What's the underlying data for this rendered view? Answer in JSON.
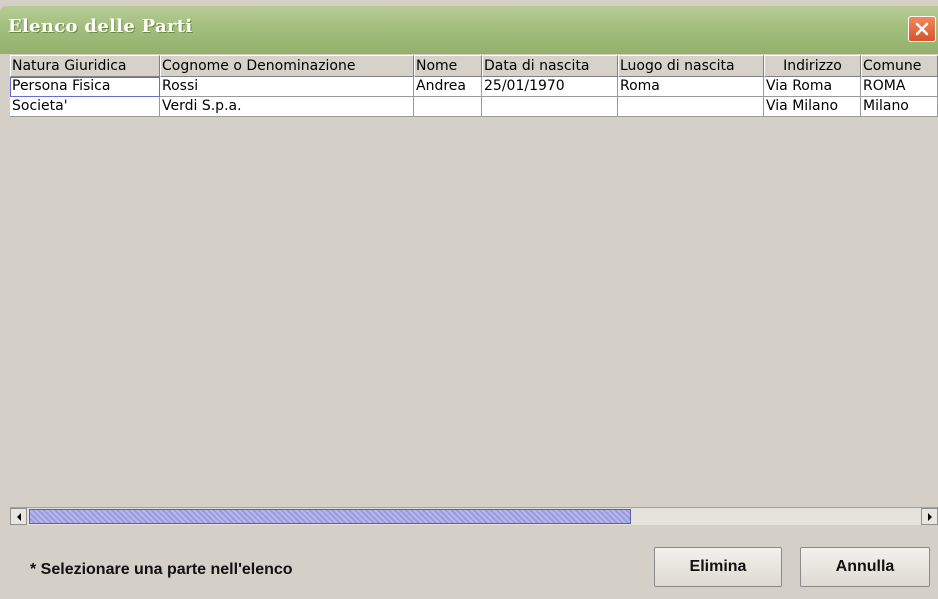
{
  "window": {
    "title": "Elenco delle Parti"
  },
  "table": {
    "columns": [
      "Natura Giuridica",
      "Cognome o Denominazione",
      "Nome",
      "Data di nascita",
      "Luogo di nascita",
      "Indirizzo",
      "Comune"
    ],
    "rows": [
      [
        "Persona Fisica",
        "Rossi",
        "Andrea",
        "25/01/1970",
        "Roma",
        "Via Roma",
        "ROMA"
      ],
      [
        "Societa'",
        "Verdi S.p.a.",
        "",
        "",
        "",
        "Via Milano",
        "Milano"
      ]
    ]
  },
  "footer": {
    "hint": "* Selezionare una parte nell'elenco",
    "elimina_label": "Elimina",
    "annulla_label": "Annulla"
  },
  "colors": {
    "title_bar": "#a3be7d",
    "close_button": "#d9532c",
    "scroll_thumb": "#a9a9e6"
  },
  "icons": {
    "close": "close-icon",
    "scroll_left": "arrow-left-icon",
    "scroll_right": "arrow-right-icon"
  }
}
